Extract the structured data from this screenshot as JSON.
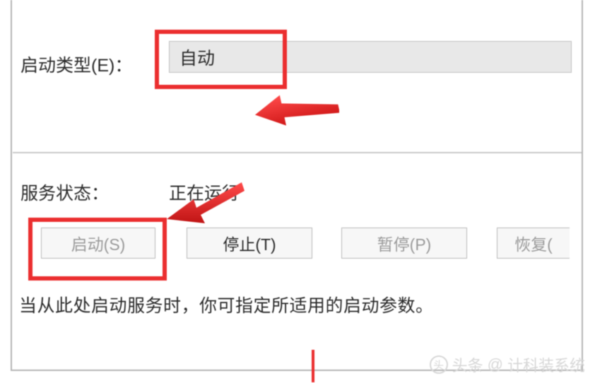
{
  "startup": {
    "label": "启动类型(E)：",
    "value": "自动"
  },
  "status": {
    "label": "服务状态：",
    "value": "正在运行"
  },
  "buttons": {
    "start": "启动(S)",
    "stop": "停止(T)",
    "pause": "暂停(P)",
    "resume": "恢复("
  },
  "hint": "当从此处启动服务时，你可指定所适用的启动参数。",
  "watermark": {
    "prefix": "头条",
    "at": "@",
    "name": "计科装系统"
  },
  "annotations": {
    "highlight_color": "#eb2e2f"
  }
}
